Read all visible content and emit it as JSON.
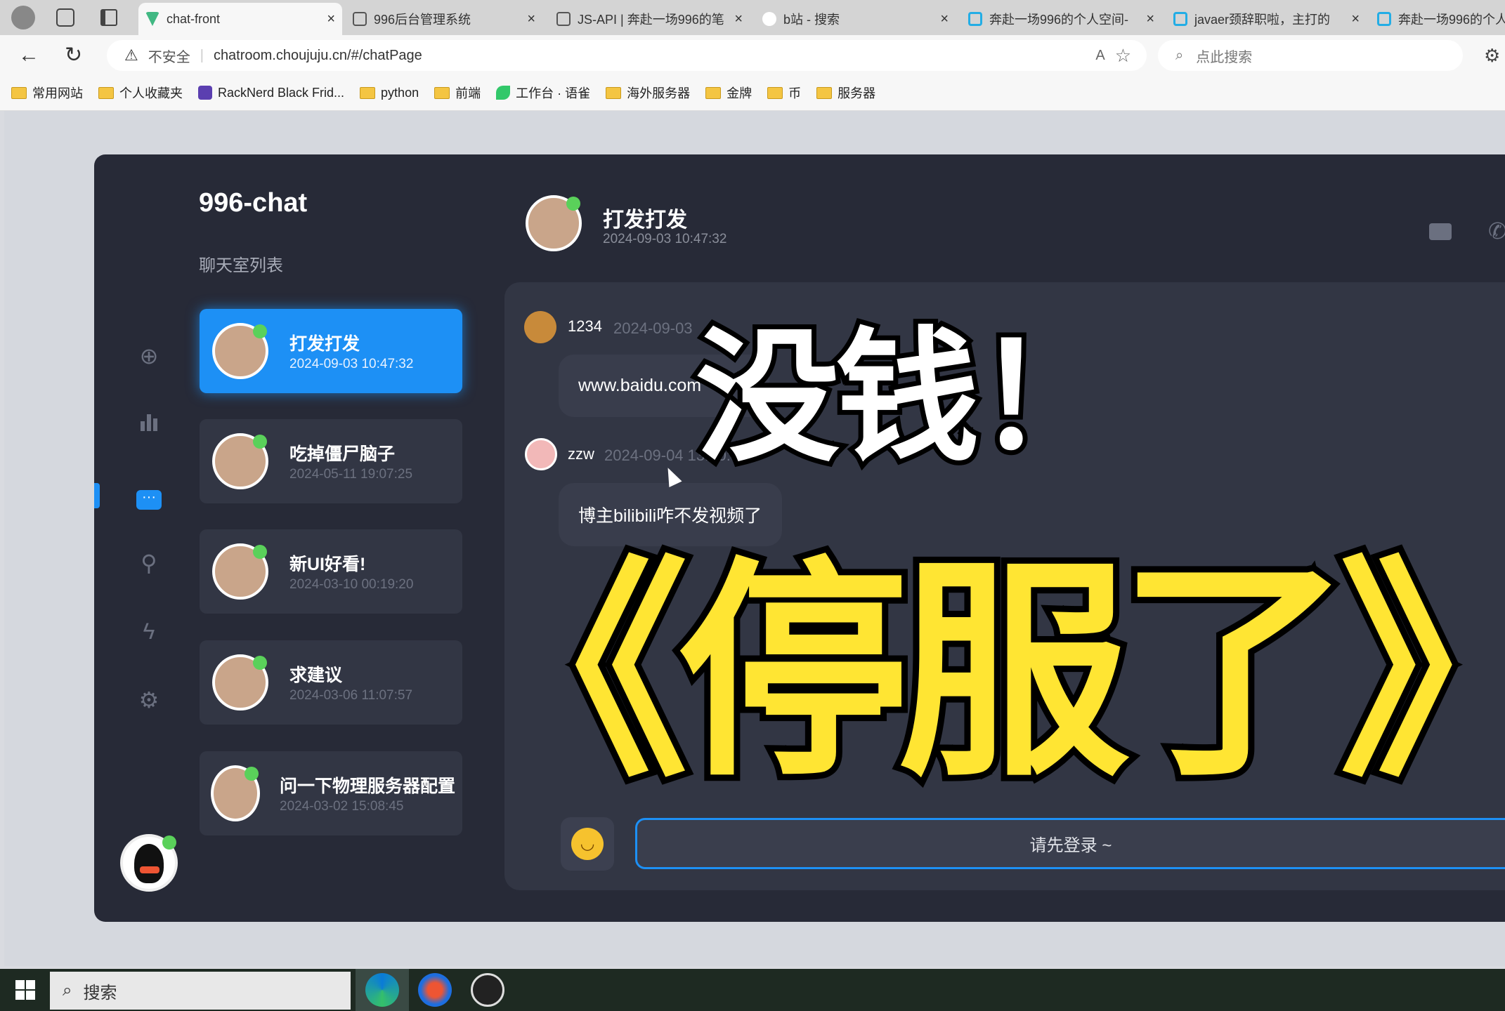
{
  "browser": {
    "tabs": [
      {
        "label": "chat-front",
        "active": true
      },
      {
        "label": "996后台管理系统"
      },
      {
        "label": "JS-API | 奔赴一场996的笔"
      },
      {
        "label": "b站 - 搜索"
      },
      {
        "label": "奔赴一场996的个人空间-"
      },
      {
        "label": "javaer颈辞职啦，主打的"
      },
      {
        "label": "奔赴一场996的个人"
      }
    ],
    "security_label": "不安全",
    "url": "chatroom.choujuju.cn/#/chatPage",
    "search_placeholder": "点此搜索",
    "bookmarks": [
      "常用网站",
      "个人收藏夹",
      "RackNerd Black Frid...",
      "python",
      "前端",
      "工作台 · 语雀",
      "海外服务器",
      "金牌",
      "币",
      "服务器"
    ]
  },
  "app": {
    "title": "996-chat",
    "room_list_label": "聊天室列表",
    "nav_icons": [
      "plus-circle-icon",
      "bar-chart-icon",
      "chat-icon",
      "antenna-icon",
      "lightning-icon",
      "gear-icon"
    ],
    "active_nav": "chat-icon",
    "rooms": [
      {
        "name": "打发打发",
        "time": "2024-09-03 10:47:32",
        "active": true
      },
      {
        "name": "吃掉僵尸脑子",
        "time": "2024-05-11 19:07:25"
      },
      {
        "name": "新UI好看!",
        "time": "2024-03-10 00:19:20"
      },
      {
        "name": "求建议",
        "time": "2024-03-06 11:07:57"
      },
      {
        "name": "问一下物理服务器配置",
        "time": "2024-03-02 15:08:45"
      }
    ],
    "chat": {
      "name": "打发打发",
      "time": "2024-09-03 10:47:32",
      "messages": [
        {
          "user": "1234",
          "time": "2024-09-03",
          "text": "www.baidu.com"
        },
        {
          "user": "zzw",
          "time": "2024-09-04 13:50:43",
          "text": "博主bilibili咋不发视频了"
        }
      ],
      "input_placeholder": "请先登录 ~"
    },
    "accent": "#1d90f5"
  },
  "overlay": {
    "caption1": "没钱！",
    "caption2": "《停服了》"
  },
  "taskbar": {
    "search_label": "搜索"
  }
}
